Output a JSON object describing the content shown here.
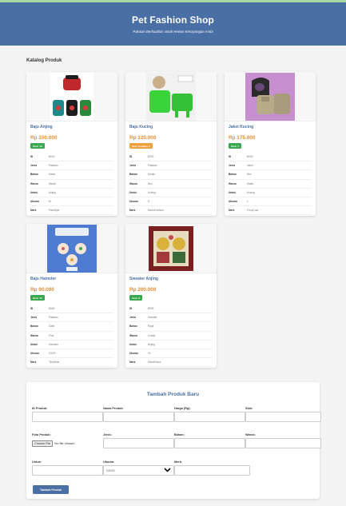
{
  "header": {
    "title": "Pet Fashion Shop",
    "subtitle": "Pakaian Berkualitas untuk Hewan Kesayangan Anda"
  },
  "catalog": {
    "title": "Katalog Produk",
    "spec_labels": {
      "id": "ID",
      "jenis": "Jenis",
      "bahan": "Bahan",
      "warna": "Warna",
      "untuk": "Untuk",
      "ukuran": "Ukuran",
      "merk": "Merk"
    },
    "products": [
      {
        "name": "Baju Anjing",
        "price": "Rp 150.000",
        "stock": "Stok: 10",
        "stock_color": "#3aa84f",
        "specs": {
          "id": "B001",
          "jenis": "Pakaian",
          "bahan": "Katun",
          "warna": "Merah",
          "untuk": "Anjing",
          "ukuran": "M",
          "merk": "PawStyle"
        }
      },
      {
        "name": "Baju Kucing",
        "price": "Rp 120.000",
        "stock": "Stok Terbatas: 5",
        "stock_color": "#f0a03a",
        "specs": {
          "id": "B002",
          "jenis": "Pakaian",
          "bahan": "Denim",
          "warna": "Biru",
          "untuk": "Kucing",
          "ukuran": "S",
          "merk": "MeowFashion"
        }
      },
      {
        "name": "Jaket Kucing",
        "price": "Rp 175.000",
        "stock": "Stok: 7",
        "stock_color": "#3aa84f",
        "specs": {
          "id": "B003",
          "jenis": "Jaket",
          "bahan": "Wol",
          "warna": "Hitam",
          "untuk": "Kucing",
          "ukuran": "L",
          "merk": "FurryCoat"
        }
      },
      {
        "name": "Baju Hamster",
        "price": "Rp 90.000",
        "stock": "Stok: 15",
        "stock_color": "#3aa84f",
        "specs": {
          "id": "B004",
          "jenis": "Pakaian",
          "bahan": "Satin",
          "warna": "Pink",
          "untuk": "Hamster",
          "ukuran": "XXXS",
          "merk": "TinyWear"
        }
      },
      {
        "name": "Sweater Anjing",
        "price": "Rp 200.000",
        "stock": "Stok: 8",
        "stock_color": "#3aa84f",
        "specs": {
          "id": "B005",
          "jenis": "Sweater",
          "bahan": "Rajut",
          "warna": "Coklat",
          "untuk": "Anjing",
          "ukuran": "XL",
          "merk": "WarmPaws"
        }
      }
    ]
  },
  "form": {
    "title": "Tambah Produk Baru",
    "labels": {
      "id": "ID Produk:",
      "nama": "Nama Produk:",
      "harga": "Harga (Rp):",
      "stok": "Stok:",
      "foto": "Foto Produk:",
      "jenis": "Jenis:",
      "bahan": "Bahan:",
      "warna": "Warna:",
      "untuk": "Untuk:",
      "ukuran": "Ukuran:",
      "merk": "Merk:"
    },
    "file_button": "Choose File",
    "file_status": "No file chosen",
    "ukuran_selected": "XXXS",
    "submit": "Tambah Produk"
  }
}
